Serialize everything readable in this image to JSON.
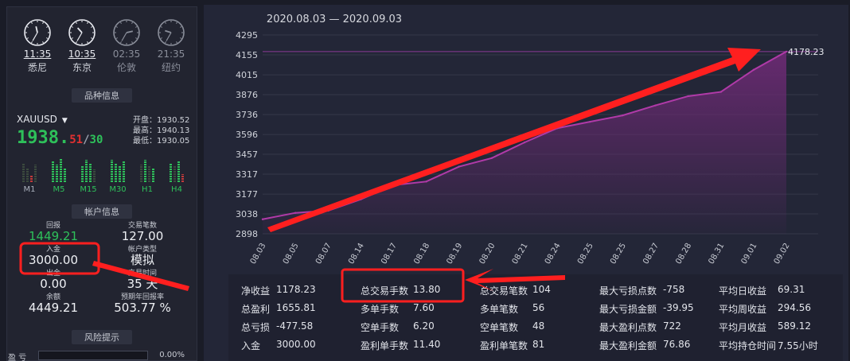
{
  "clocks": [
    {
      "time": "11:35",
      "city": "悉尼",
      "dim": false,
      "h": 11,
      "m": 35
    },
    {
      "time": "10:35",
      "city": "东京",
      "dim": false,
      "h": 10,
      "m": 35
    },
    {
      "time": "02:35",
      "city": "伦敦",
      "dim": true,
      "h": 2,
      "m": 35
    },
    {
      "time": "21:35",
      "city": "纽约",
      "dim": true,
      "h": 21,
      "m": 35
    }
  ],
  "sections": {
    "product": "品种信息",
    "account": "帐户信息",
    "risk": "风险提示"
  },
  "quote": {
    "symbol": "XAUUSD",
    "price_main": "1938.",
    "price_a": "51",
    "price_sep": "/",
    "price_b": "30",
    "open_label": "开盘：",
    "open": "1930.52",
    "high_label": "最高：",
    "high": "1940.13",
    "low_label": "最低：",
    "low": "1930.05"
  },
  "timeframes": [
    {
      "label": "M1",
      "active": false
    },
    {
      "label": "M5",
      "active": true
    },
    {
      "label": "M15",
      "active": true
    },
    {
      "label": "M30",
      "active": true
    },
    {
      "label": "H1",
      "active": true
    },
    {
      "label": "H4",
      "active": true
    }
  ],
  "account": {
    "profit_label": "回报",
    "profit": "1449.21",
    "trades_label": "交易笔数",
    "trades": "127.00",
    "deposit_label": "入金",
    "deposit": "3000.00",
    "type_label": "帐户类型",
    "type": "模拟",
    "withdraw_label": "出金",
    "withdraw": "0.00",
    "duration_label": "交易时间",
    "duration": "35 天",
    "balance_label": "余额",
    "balance": "4449.21",
    "annual_label": "预期年回报率",
    "annual": "503.77 %"
  },
  "risk": {
    "label": "盈 亏",
    "pct": "0.00%"
  },
  "chart_data": {
    "type": "area",
    "title": "2020.08.03 — 2020.09.03",
    "categories": [
      "08.03",
      "08.05",
      "08.07",
      "08.14",
      "08.17",
      "08.18",
      "08.19",
      "08.20",
      "08.21",
      "08.24",
      "08.25",
      "08.25",
      "08.27",
      "08.28",
      "08.31",
      "09.01",
      "09.02"
    ],
    "values": [
      3000,
      3045,
      3060,
      3140,
      3240,
      3265,
      3370,
      3430,
      3540,
      3640,
      3685,
      3730,
      3800,
      3865,
      3895,
      4050,
      4178.23
    ],
    "yticks": [
      "4295",
      "4155",
      "4015",
      "3876",
      "3736",
      "3596",
      "3457",
      "3317",
      "3177",
      "3038",
      "2898"
    ],
    "ylim": [
      2898,
      4295
    ],
    "last_label": "4178.23",
    "colors": {
      "line": "#b03aa8",
      "fill": "#6a2a72",
      "ref": "#8a3a96"
    }
  },
  "stats": {
    "col1": [
      {
        "k": "净收益",
        "v": "1178.23"
      },
      {
        "k": "总盈利",
        "v": "1655.81"
      },
      {
        "k": "总亏损",
        "v": "-477.58"
      },
      {
        "k": "入金",
        "v": "3000.00"
      }
    ],
    "col2": [
      {
        "k": "总交易手数",
        "v": "13.80"
      },
      {
        "k": "多单手数",
        "v": "7.60"
      },
      {
        "k": "空单手数",
        "v": "6.20"
      },
      {
        "k": "盈利单手数",
        "v": "11.40"
      }
    ],
    "col3": [
      {
        "k": "总交易笔数",
        "v": "104"
      },
      {
        "k": "多单笔数",
        "v": "56"
      },
      {
        "k": "空单笔数",
        "v": "48"
      },
      {
        "k": "盈利单笔数",
        "v": "81"
      }
    ],
    "col4": [
      {
        "k": "最大亏损点数",
        "v": "-758"
      },
      {
        "k": "最大亏损金额",
        "v": "-39.95"
      },
      {
        "k": "最大盈利点数",
        "v": "722"
      },
      {
        "k": "最大盈利金额",
        "v": "76.86"
      }
    ],
    "col5": [
      {
        "k": "平均日收益",
        "v": "69.31"
      },
      {
        "k": "平均周收益",
        "v": "294.56"
      },
      {
        "k": "平均月收益",
        "v": "589.12"
      },
      {
        "k": "平均持仓时间",
        "v": "7.55小时"
      }
    ]
  },
  "colors": {
    "accent_green": "#2ec05a",
    "accent_red": "#e03030",
    "annotation": "#ff1f1f"
  }
}
